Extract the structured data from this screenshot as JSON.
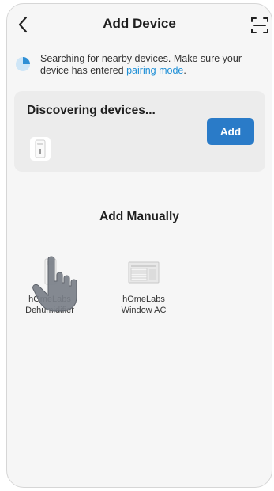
{
  "header": {
    "title": "Add Device",
    "back_icon": "chevron-left-icon",
    "scan_icon": "scan-icon"
  },
  "tip": {
    "text_before": "Searching for nearby devices. Make sure your device has entered ",
    "link": "pairing mode",
    "text_after": ".",
    "icon": "radar-icon",
    "accent": "#1e8fd6"
  },
  "discover": {
    "title": "Discovering devices...",
    "add_label": "Add",
    "button_color": "#2a7bc8",
    "device_icon": "dehumidifier-icon"
  },
  "manual": {
    "title": "Add Manually",
    "items": [
      {
        "label_line1": "hOmeLabs",
        "label_line2": "Dehumidifier",
        "icon": "dehumidifier-icon"
      },
      {
        "label_line1": "hOmeLabs",
        "label_line2": "Window AC",
        "icon": "window-ac-icon"
      }
    ]
  }
}
